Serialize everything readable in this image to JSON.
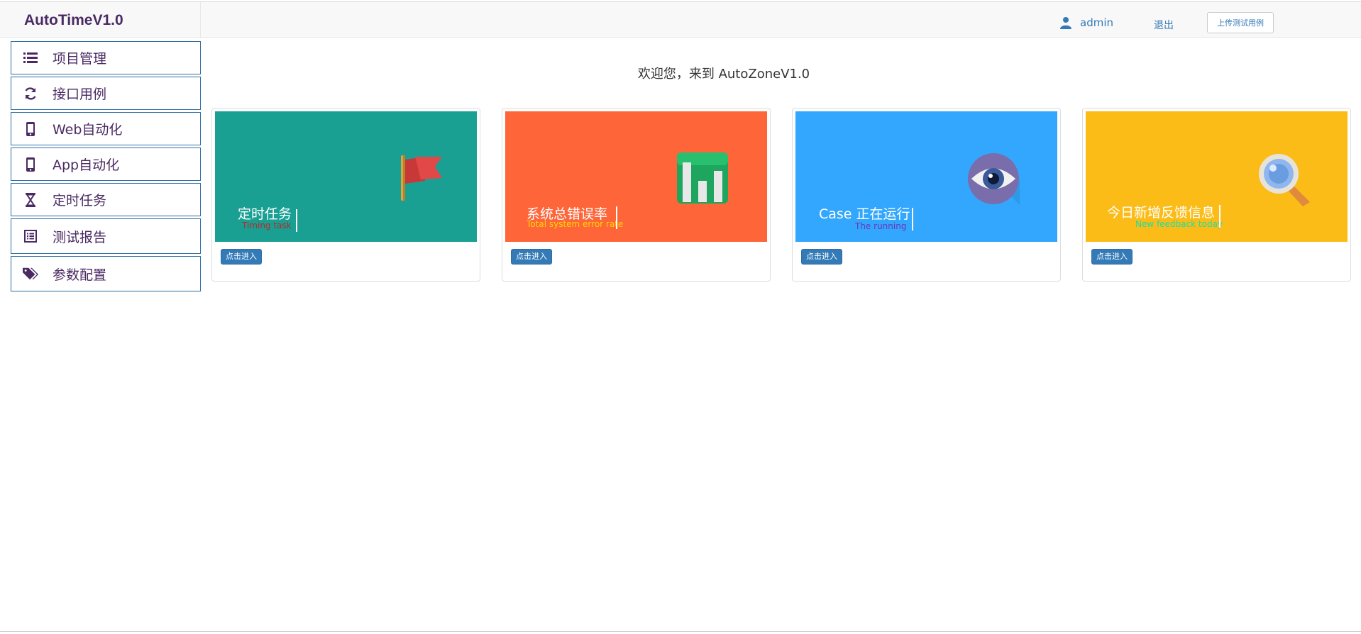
{
  "navbar": {
    "brand": "AutoTimeV1.0",
    "user": "admin",
    "logout": "退出",
    "upload": "上传测试用例"
  },
  "sidebar": {
    "items": [
      {
        "label": "项目管理",
        "icon": "list-icon"
      },
      {
        "label": "接口用例",
        "icon": "refresh-icon"
      },
      {
        "label": "Web自动化",
        "icon": "phone-icon"
      },
      {
        "label": "App自动化",
        "icon": "phone-icon"
      },
      {
        "label": "定时任务",
        "icon": "hourglass-icon"
      },
      {
        "label": "测试报告",
        "icon": "report-icon"
      },
      {
        "label": "参数配置",
        "icon": "tags-icon"
      }
    ]
  },
  "main": {
    "welcome": "欢迎您，来到 AutoZoneV1.0",
    "cards": [
      {
        "title": "定时任务",
        "subtitle": "Timing task",
        "button": "点击进入",
        "color": "#19a093",
        "sub_color": "#b52a2a",
        "icon": "flag-icon"
      },
      {
        "title": "系统总错误率",
        "subtitle": "Total system error rate",
        "button": "点击进入",
        "color": "#fe6539",
        "sub_color": "#ffd800",
        "icon": "bar-chart-icon"
      },
      {
        "title": "Case 正在运行",
        "subtitle": "The running",
        "button": "点击进入",
        "color": "#33a7fd",
        "sub_color": "#6a36b8",
        "icon": "eye-icon"
      },
      {
        "title": "今日新增反馈信息",
        "subtitle": "New feedback today",
        "button": "点击进入",
        "color": "#fbbc18",
        "sub_color": "#16e0a8",
        "icon": "magnifier-icon"
      }
    ]
  }
}
